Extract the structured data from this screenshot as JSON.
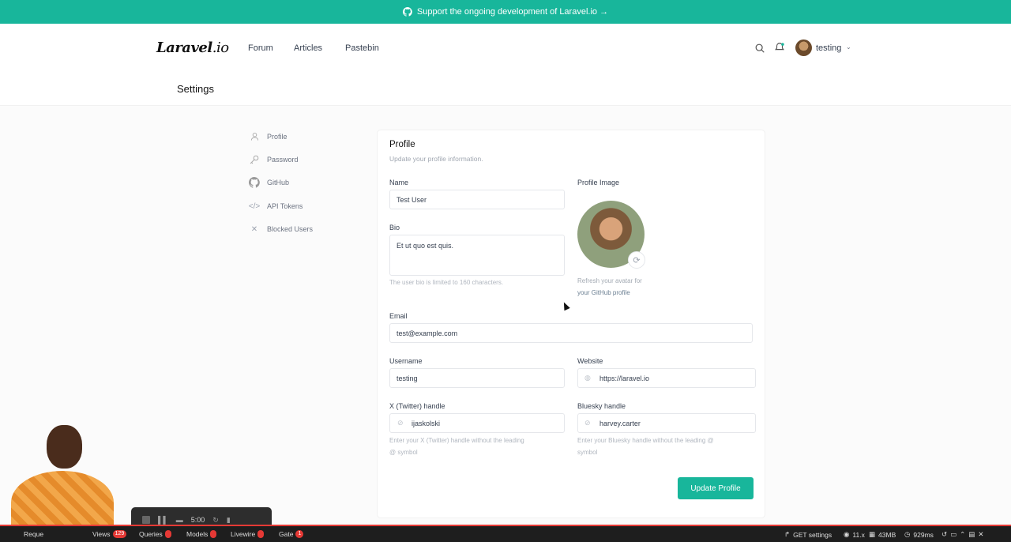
{
  "banner": {
    "text": "Support the ongoing development of Laravel.io →"
  },
  "nav": {
    "logo_main": "Laravel",
    "logo_suffix": ".io",
    "links": [
      "Forum",
      "Articles",
      "Pastebin"
    ],
    "user": "testing"
  },
  "page": {
    "title": "Settings"
  },
  "sidebar": {
    "items": [
      {
        "label": "Profile",
        "icon": "user-icon"
      },
      {
        "label": "Password",
        "icon": "key-icon"
      },
      {
        "label": "GitHub",
        "icon": "github-icon"
      },
      {
        "label": "API Tokens",
        "icon": "code-icon"
      },
      {
        "label": "Blocked Users",
        "icon": "x-icon"
      }
    ]
  },
  "profile": {
    "title": "Profile",
    "subtitle": "Update your profile information.",
    "name_label": "Name",
    "name_value": "Test User",
    "bio_label": "Bio",
    "bio_value": "Et ut quo est quis.",
    "bio_hint": "The user bio is limited to 160 characters.",
    "image_label": "Profile Image",
    "refresh_hint_1": "Refresh your avatar for",
    "refresh_hint_2": "your GitHub profile",
    "email_label": "Email",
    "email_value": "test@example.com",
    "username_label": "Username",
    "username_value": "testing",
    "website_label": "Website",
    "website_value": "https://laravel.io",
    "twitter_label": "X (Twitter) handle",
    "twitter_value": "ijaskolski",
    "twitter_hint_1": "Enter your X (Twitter) handle without the leading",
    "twitter_hint_2": "@ symbol",
    "bluesky_label": "Bluesky handle",
    "bluesky_value": "harvey.carter",
    "bluesky_hint_1": "Enter your Bluesky handle without the leading @",
    "bluesky_hint_2": "symbol",
    "update_button": "Update Profile"
  },
  "recorder": {
    "time": "5:00"
  },
  "debugbar": {
    "requests": "Reque",
    "views_label": "Views",
    "views_count": "129",
    "queries_label": "Queries",
    "models_label": "Models",
    "livewire_label": "Livewire",
    "gate_label": "Gate",
    "gate_count": "1",
    "route": "GET settings",
    "php": "11.x",
    "memory": "43MB",
    "time": "929ms"
  },
  "colors": {
    "accent": "#18b69b",
    "debug_red": "#e53935"
  }
}
